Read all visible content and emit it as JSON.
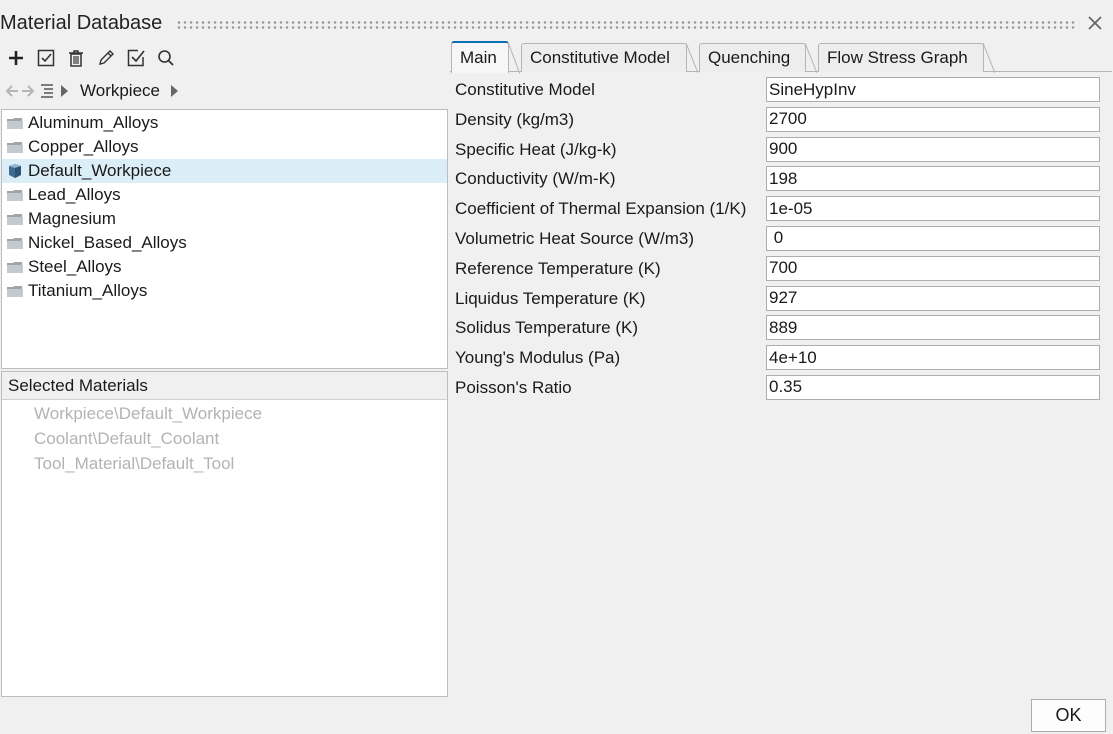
{
  "window": {
    "title": "Material Database"
  },
  "toolbar": {
    "icons": [
      "plus-icon",
      "checkbox-edit-icon",
      "trash-icon",
      "pencil-icon",
      "checkbox-check-icon",
      "search-icon"
    ]
  },
  "breadcrumb": {
    "current": "Workpiece"
  },
  "tree": {
    "items": [
      {
        "label": "Aluminum_Alloys",
        "icon": "folder-icon",
        "selected": false
      },
      {
        "label": "Copper_Alloys",
        "icon": "folder-icon",
        "selected": false
      },
      {
        "label": "Default_Workpiece",
        "icon": "material-cube-icon",
        "selected": true
      },
      {
        "label": "Lead_Alloys",
        "icon": "folder-icon",
        "selected": false
      },
      {
        "label": "Magnesium",
        "icon": "folder-icon",
        "selected": false
      },
      {
        "label": "Nickel_Based_Alloys",
        "icon": "folder-icon",
        "selected": false
      },
      {
        "label": "Steel_Alloys",
        "icon": "folder-icon",
        "selected": false
      },
      {
        "label": "Titanium_Alloys",
        "icon": "folder-icon",
        "selected": false
      }
    ]
  },
  "selected_materials": {
    "header": "Selected Materials",
    "items": [
      "Workpiece\\Default_Workpiece",
      "Coolant\\Default_Coolant",
      "Tool_Material\\Default_Tool"
    ]
  },
  "tabs": [
    {
      "label": "Main",
      "active": true
    },
    {
      "label": "Constitutive Model",
      "active": false
    },
    {
      "label": "Quenching",
      "active": false
    },
    {
      "label": "Flow Stress Graph",
      "active": false
    }
  ],
  "properties": [
    {
      "label": "Constitutive Model",
      "value": "SineHypInv"
    },
    {
      "label": "Density (kg/m3)",
      "value": "2700"
    },
    {
      "label": "Specific Heat (J/kg-k)",
      "value": "900"
    },
    {
      "label": "Conductivity (W/m-K)",
      "value": "198"
    },
    {
      "label": "Coefficient of Thermal Expansion (1/K)",
      "value": "1e-05"
    },
    {
      "label": "Volumetric Heat Source (W/m3)",
      "value": " 0"
    },
    {
      "label": "Reference Temperature (K)",
      "value": "700"
    },
    {
      "label": "Liquidus Temperature (K)",
      "value": "927"
    },
    {
      "label": "Solidus Temperature (K)",
      "value": "889"
    },
    {
      "label": "Young's Modulus (Pa)",
      "value": "4e+10"
    },
    {
      "label": "Poisson's Ratio",
      "value": "0.35"
    }
  ],
  "footer": {
    "ok_label": "OK"
  },
  "colors": {
    "selection": "#dbeef8",
    "tab_accent": "#0a6fb4",
    "disabled_text": "#b3b3b3"
  }
}
